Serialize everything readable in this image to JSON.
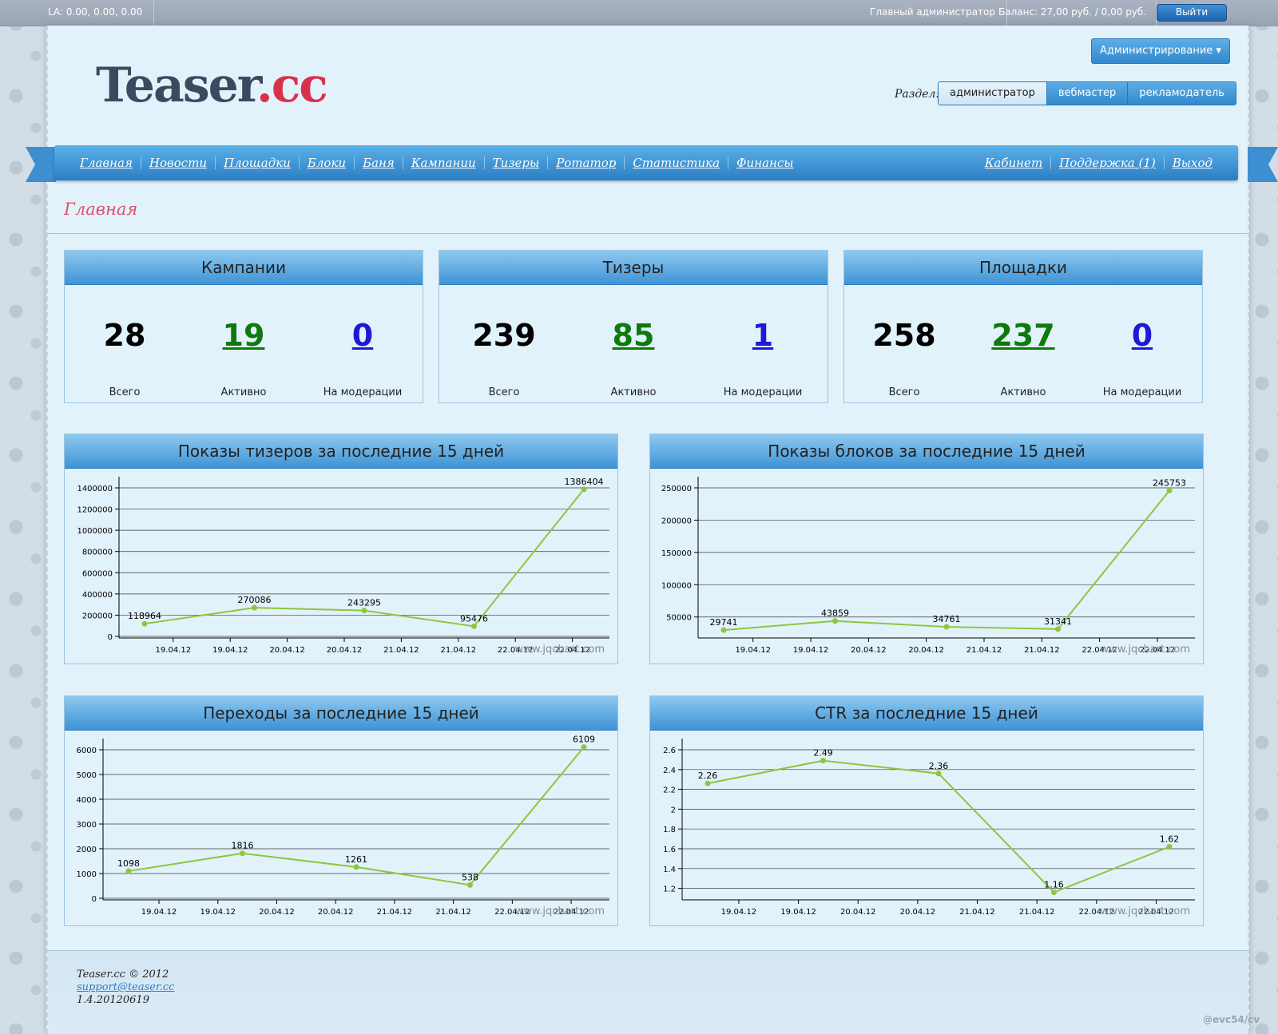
{
  "topbar": {
    "la": "LA: 0.00, 0.00, 0.00",
    "admin": "Главный администратор",
    "balance": "Баланс: 27,00 руб. / 0,00 руб.",
    "logout": "Выйти"
  },
  "header": {
    "logo_main": "Teaser",
    "logo_dot": ".",
    "logo_tld": "cc",
    "admin_menu": "Администрирование ▾",
    "section_label": "Раздел:",
    "sections": [
      "администратор",
      "вебмастер",
      "рекламодатель"
    ]
  },
  "nav": {
    "left": [
      "Главная",
      "Новости",
      "Площадки",
      "Блоки",
      "Баня",
      "Кампании",
      "Тизеры",
      "Ротатор",
      "Статистика",
      "Финансы"
    ],
    "right": [
      "Кабинет",
      "Поддержка (1)",
      "Выход"
    ]
  },
  "page_title": "Главная",
  "stats": [
    {
      "title": "Кампании",
      "total": "28",
      "active": "19",
      "moderation": "0"
    },
    {
      "title": "Тизеры",
      "total": "239",
      "active": "85",
      "moderation": "1"
    },
    {
      "title": "Площадки",
      "total": "258",
      "active": "237",
      "moderation": "0"
    }
  ],
  "stat_labels": {
    "total": "Всего",
    "active": "Активно",
    "moderation": "На модерации"
  },
  "watermark": "www.jqchart.com",
  "chart_data": [
    {
      "type": "line",
      "title": "Показы тизеров за последние 15 дней",
      "x_ticks": [
        "19.04.12",
        "19.04.12",
        "20.04.12",
        "20.04.12",
        "21.04.12",
        "21.04.12",
        "22.04.12",
        "22.04.12"
      ],
      "values": [
        118964,
        270086,
        243295,
        95476,
        1386404
      ],
      "y_ticks": [
        0,
        200000,
        400000,
        600000,
        800000,
        1000000,
        1200000,
        1400000
      ],
      "ylim": [
        0,
        1400000
      ],
      "color": "#8dc63f"
    },
    {
      "type": "line",
      "title": "Показы блоков за последние 15 дней",
      "x_ticks": [
        "19.04.12",
        "19.04.12",
        "20.04.12",
        "20.04.12",
        "21.04.12",
        "21.04.12",
        "22.04.12",
        "22.04.12"
      ],
      "values": [
        29741,
        43859,
        34761,
        31341,
        245753
      ],
      "y_ticks": [
        50000,
        100000,
        150000,
        200000,
        250000
      ],
      "ylim": [
        20000,
        250000
      ],
      "color": "#8dc63f"
    },
    {
      "type": "line",
      "title": "Переходы за последние 15 дней",
      "x_ticks": [
        "19.04.12",
        "19.04.12",
        "20.04.12",
        "20.04.12",
        "21.04.12",
        "21.04.12",
        "22.04.12",
        "22.04.12"
      ],
      "values": [
        1098,
        1816,
        1261,
        538,
        6109
      ],
      "y_ticks": [
        0,
        1000,
        2000,
        3000,
        4000,
        5000,
        6000
      ],
      "ylim": [
        0,
        6000
      ],
      "color": "#8dc63f"
    },
    {
      "type": "line",
      "title": "CTR за последние 15 дней",
      "x_ticks": [
        "19.04.12",
        "19.04.12",
        "20.04.12",
        "20.04.12",
        "21.04.12",
        "21.04.12",
        "22.04.12",
        "22.04.12"
      ],
      "values": [
        2.26,
        2.49,
        2.36,
        1.16,
        1.62
      ],
      "y_ticks": [
        "1.2",
        "1.4",
        "1.6",
        "1.8",
        "2",
        "2.2",
        "2.4",
        "2.6"
      ],
      "ylim": [
        1.1,
        2.6
      ],
      "color": "#8dc63f"
    }
  ],
  "footer": {
    "copyright": "Teaser.cc © 2012",
    "email": "support@teaser.cc",
    "version": "1.4.20120619"
  },
  "credit": "@evc54/cv"
}
